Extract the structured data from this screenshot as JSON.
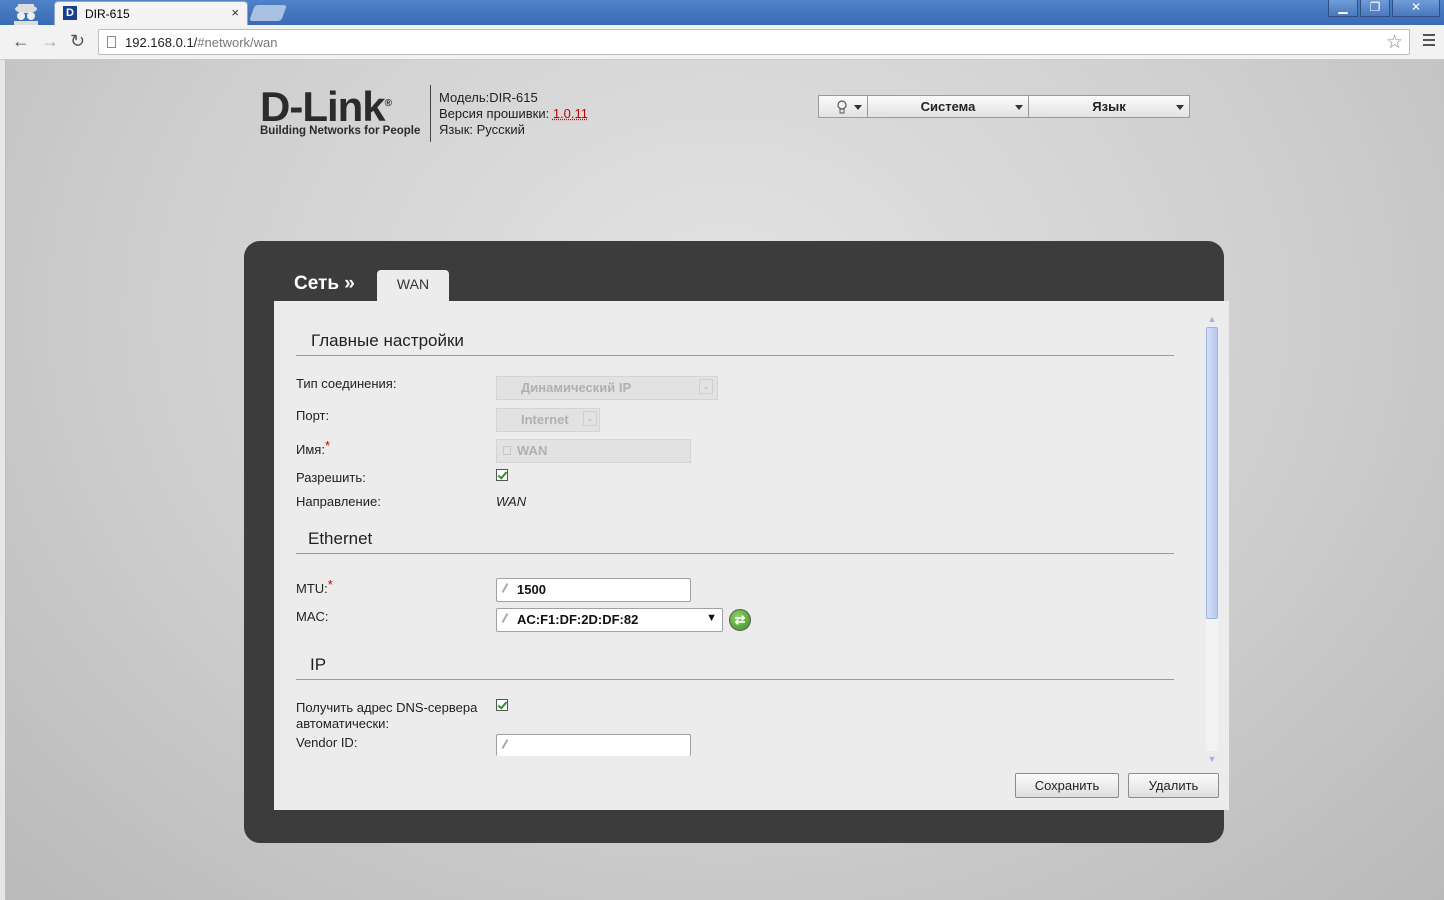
{
  "browser": {
    "tab_title": "DIR-615",
    "tab_close": "×",
    "favicon": "D",
    "url_host": "192.168.0.1/",
    "url_path": "#network/wan",
    "window_buttons": [
      "▁",
      "❐",
      "✕"
    ],
    "icons": [
      "incognito-icon",
      "back-icon",
      "forward-icon",
      "reload-icon",
      "bookmark-star-icon",
      "menu-icon"
    ]
  },
  "header": {
    "brand": "D-Link",
    "brand_mark": "®",
    "tagline": "Building Networks for People",
    "model_label": "Модель:",
    "model_value": "DIR-615",
    "firmware_label": "Версия прошивки:",
    "firmware_value": "1.0.11",
    "language_label": "Язык:",
    "language_value": "Русский",
    "menu": {
      "hints_icon": "lightbulb-icon",
      "system": "Система",
      "language": "Язык"
    }
  },
  "breadcrumb": {
    "section": "Сеть »",
    "tab": "WAN"
  },
  "main_settings": {
    "title": "Главные настройки",
    "connection_type_label": "Тип соединения:",
    "connection_type_value": "Динамический IP",
    "port_label": "Порт:",
    "port_value": "Internet",
    "name_label": "Имя:",
    "name_value": "WAN",
    "required_mark": "*",
    "enable_label": "Разрешить:",
    "enable_checked": true,
    "direction_label": "Направление:",
    "direction_value": "WAN"
  },
  "ethernet": {
    "title": "Ethernet",
    "mtu_label": "MTU:",
    "mtu_value": "1500",
    "mac_label": "MAC:",
    "mac_value": "AC:F1:DF:2D:DF:82",
    "mac_dropdown_arrow": "▼"
  },
  "ip": {
    "title": "IP",
    "dns_auto_label_line1": "Получить адрес DNS-сервера",
    "dns_auto_label_line2": "автоматически:",
    "dns_auto_checked": true,
    "vendor_id_label": "Vendor ID:",
    "vendor_id_value": ""
  },
  "actions": {
    "save": "Сохранить",
    "delete": "Удалить"
  },
  "colors": {
    "accent_red": "#c40000",
    "frame": "#3c3c3c",
    "panel": "#ececec",
    "chrome_blue": "#3a6cb5"
  }
}
